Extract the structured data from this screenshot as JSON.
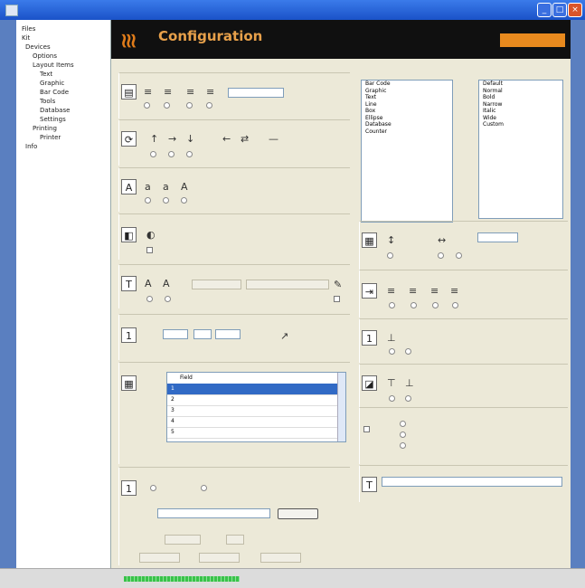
{
  "window": {
    "title": ""
  },
  "tree": {
    "items": [
      "Files",
      "Kit",
      "Devices",
      "Options",
      "Layout Items",
      "Text",
      "Graphic",
      "Bar Code",
      "Tools",
      "Database",
      "Settings",
      "Printing",
      "Printer",
      "Info"
    ]
  },
  "banner": {
    "title": "Configuration",
    "subtitle": "",
    "button_label": ""
  },
  "list_left": {
    "items": [
      "Bar Code",
      "Graphic",
      "Text",
      "Line",
      "Box",
      "Ellipse",
      "Database",
      "Counter"
    ]
  },
  "list_right": {
    "items": [
      "Default",
      "Normal",
      "Bold",
      "Narrow",
      "Italic",
      "Wide",
      "Custom"
    ]
  },
  "grid": {
    "header": "Field",
    "rows": [
      {
        "num": "1",
        "name": ""
      },
      {
        "num": "2",
        "name": ""
      },
      {
        "num": "3",
        "name": ""
      },
      {
        "num": "4",
        "name": ""
      },
      {
        "num": "5",
        "name": ""
      }
    ]
  },
  "bottom": {
    "text_field_value": "",
    "browse_button": ""
  },
  "status": {
    "text": ""
  },
  "progress": {
    "fraction": 0.35
  }
}
